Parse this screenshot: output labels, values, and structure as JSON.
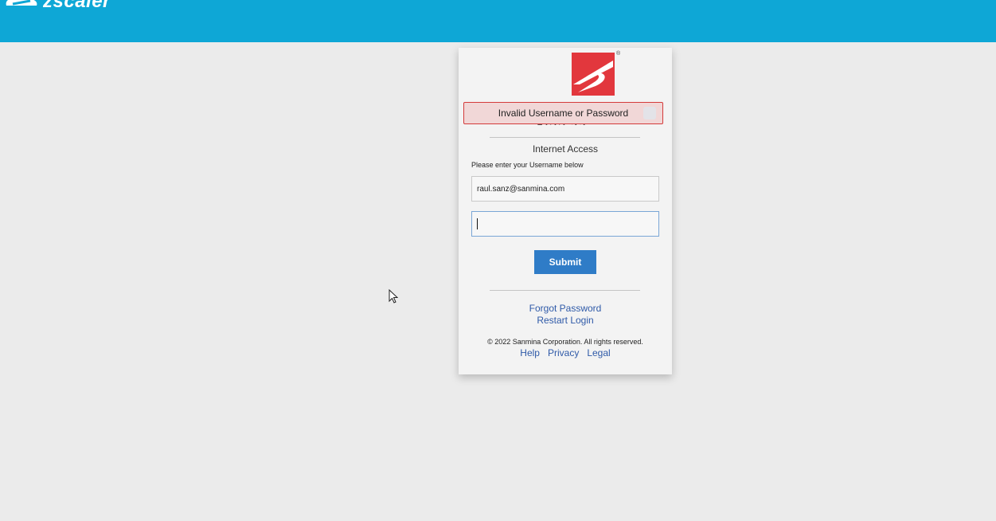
{
  "header": {
    "brand_name": "zscaler",
    "background_color": "#0ea7d6"
  },
  "login_card": {
    "logo_icon": "sanmina-logo-icon",
    "registered_mark": "®",
    "error_message": "Invalid Username or Password",
    "obscured_text": "SECURE ACCESS",
    "section_title": "Internet Access",
    "prompt": "Please enter your Username below",
    "username_value": "raul.sanz@sanmina.com",
    "password_value": "",
    "submit_label": "Submit",
    "forgot_password_label": "Forgot Password",
    "restart_login_label": "Restart Login",
    "copyright": "© 2022 Sanmina Corporation. All rights reserved.",
    "footer_links": [
      "Help",
      "Privacy",
      "Legal"
    ],
    "colors": {
      "error_border": "#d43a3a",
      "error_background": "#f1d7d7",
      "submit_button": "#2f7cc7",
      "link": "#2f5aa8",
      "logo_red": "#e2373d"
    }
  }
}
